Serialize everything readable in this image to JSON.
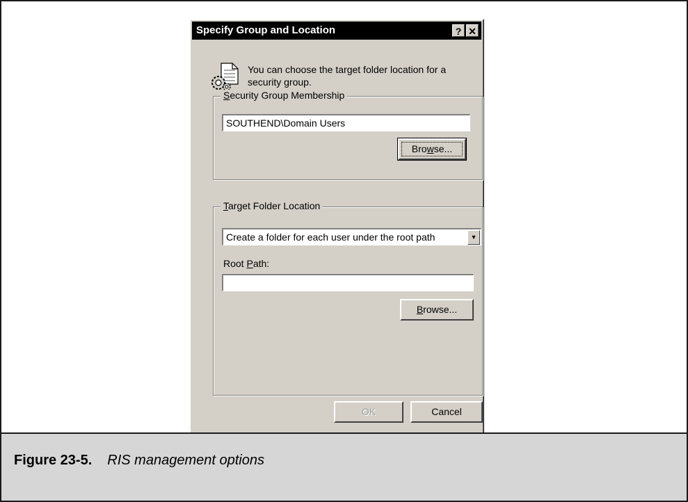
{
  "dialog": {
    "title": "Specify Group and Location",
    "help_glyph": "?",
    "close_glyph": "✕",
    "intro_icon": "document-gear-icon",
    "intro_text": "You can choose the target folder location for a security group.",
    "security_group": {
      "label_key": "S",
      "label_rest": "ecurity Group Membership",
      "value": "SOUTHEND\\Domain Users",
      "browse_pre": "Bro",
      "browse_key": "w",
      "browse_post": "se..."
    },
    "target_folder": {
      "label_key": "T",
      "label_rest": "arget Folder Location",
      "selected_option": "Create a folder for each user under the root path",
      "root_path_pre": "Root ",
      "root_path_key": "P",
      "root_path_post": "ath:",
      "root_path_value": "",
      "browse_key": "B",
      "browse_post": "rowse..."
    },
    "ok_label": "OK",
    "cancel_label": "Cancel"
  },
  "caption": {
    "number": "Figure 23-5.",
    "title": "RIS management options"
  }
}
